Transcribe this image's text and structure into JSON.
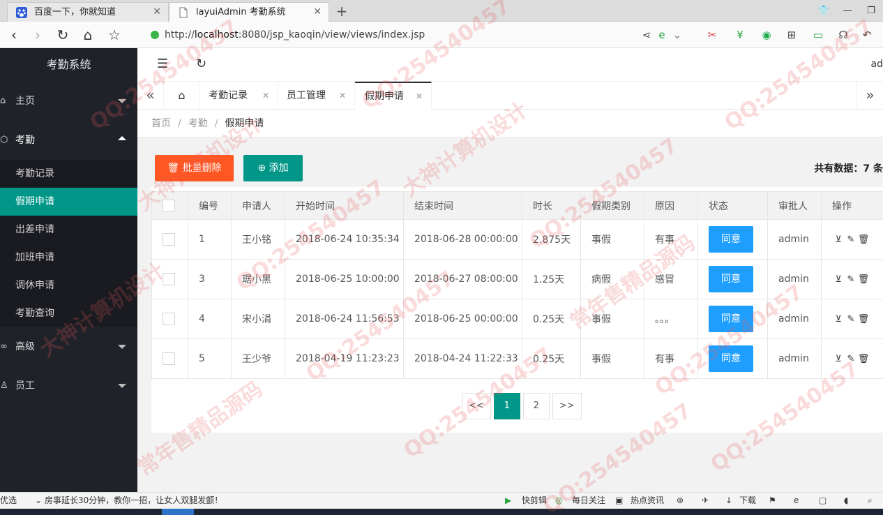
{
  "browser": {
    "tabs": [
      {
        "title": "百度一下，你就知道",
        "icon": "baidu-paw-icon"
      },
      {
        "title": "layuiAdmin 考勤系统",
        "icon": "document-icon"
      }
    ],
    "url_prefix": "http://",
    "url_host": "localhost",
    "url_rest": ":8080/jsp_kaoqin/view/views/index.jsp"
  },
  "sidebar": {
    "logo": "考勤系统",
    "groups": {
      "home": "主页",
      "attendance": "考勤",
      "advanced": "高级",
      "staff": "员工"
    },
    "items": [
      "考勤记录",
      "假期申请",
      "出差申请",
      "加班申请",
      "调休申请",
      "考勤查询"
    ]
  },
  "header": {
    "user": "ad"
  },
  "page_tabs": [
    "考勤记录",
    "员工管理",
    "假期申请"
  ],
  "breadcrumb": {
    "home": "首页",
    "sep": "/",
    "level2": "考勤",
    "current": "假期申请"
  },
  "toolbar": {
    "batch_delete": "批量删除",
    "add": "添加",
    "total": "共有数据：7 条"
  },
  "table": {
    "headers": [
      "编号",
      "申请人",
      "开始时间",
      "结束时间",
      "时长",
      "假期类别",
      "原因",
      "状态",
      "审批人",
      "操作"
    ],
    "rows": [
      {
        "id": "1",
        "applicant": "王小铭",
        "start": "2018-06-24 10:35:34",
        "end": "2018-06-28 00:00:00",
        "duration": "2.875天",
        "type": "事假",
        "reason": "有事",
        "status": "同意",
        "approver": "admin"
      },
      {
        "id": "3",
        "applicant": "琚小黑",
        "start": "2018-06-25 10:00:00",
        "end": "2018-06-27 08:00:00",
        "duration": "1.25天",
        "type": "病假",
        "reason": "感冒",
        "status": "同意",
        "approver": "admin"
      },
      {
        "id": "4",
        "applicant": "宋小涓",
        "start": "2018-06-24 11:56:53",
        "end": "2018-06-25 00:00:00",
        "duration": "0.25天",
        "type": "事假",
        "reason": "。。。",
        "status": "同意",
        "approver": "admin"
      },
      {
        "id": "5",
        "applicant": "王少爷",
        "start": "2018-04-19 11:23:23",
        "end": "2018-04-24 11:22:33",
        "duration": "0.25天",
        "type": "事假",
        "reason": "有事",
        "status": "同意",
        "approver": "admin"
      }
    ]
  },
  "pagination": {
    "prev": "<<",
    "pages": [
      "1",
      "2"
    ],
    "next": ">>"
  },
  "status_bar": {
    "left": "优选",
    "news": "房事延长30分钟，教你一招，让女人双腿发颤！",
    "items": [
      "快剪辑",
      "每日关注",
      "热点资讯",
      "下载"
    ]
  },
  "watermark": {
    "texts": [
      "QQ:254540457",
      "大神计算机设计",
      "常年售精品源码"
    ]
  },
  "colors": {
    "sidebar_bg": "#20222a",
    "accent_teal": "#009688",
    "danger_orange": "#ff5722",
    "status_blue": "#1e9fff"
  }
}
